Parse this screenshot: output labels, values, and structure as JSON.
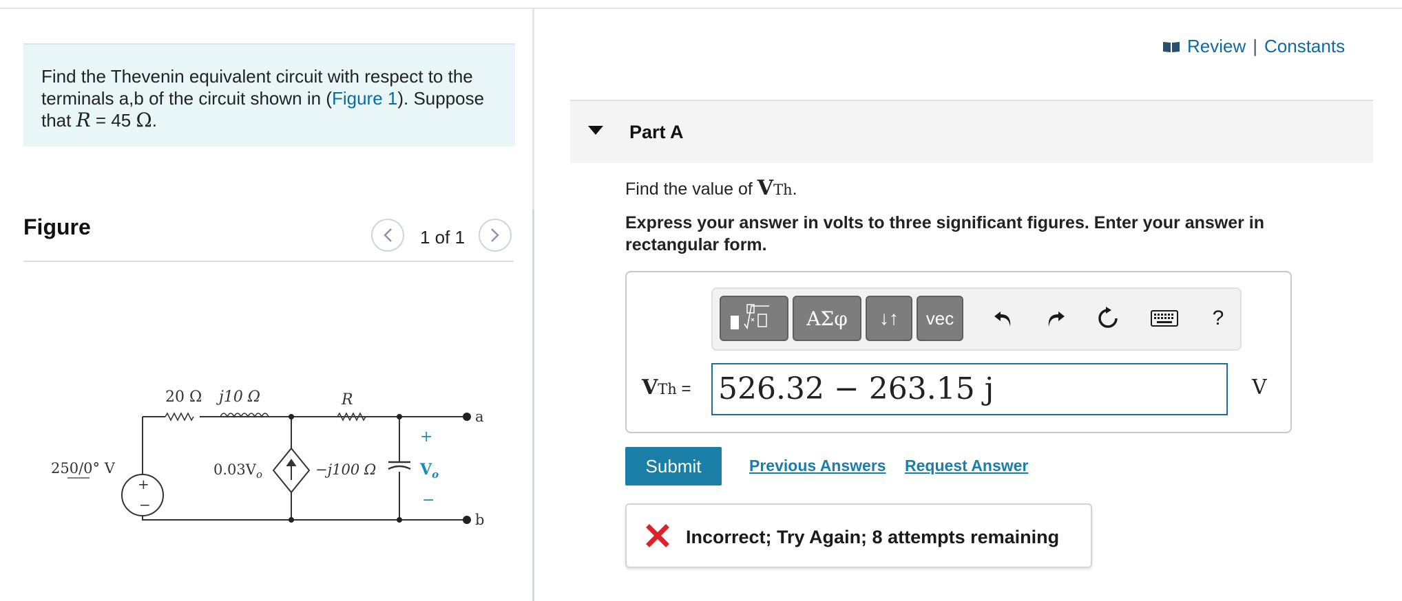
{
  "problem": {
    "text_before": "Find the Thevenin equivalent circuit with respect to the terminals a,b of the circuit shown in (",
    "figure_link": "Figure 1",
    "text_after": "). Suppose that ",
    "r_symbol": "R",
    "r_value": " = 45 ",
    "r_unit": "Ω",
    "period": "."
  },
  "figure": {
    "title": "Figure",
    "counter": "1 of 1",
    "prev_icon": "chevron-left-icon",
    "next_icon": "chevron-right-icon",
    "circuit": {
      "r1_label": "20 Ω",
      "l1_label": "j10 Ω",
      "r_label": "R",
      "source_label": "250/0° V",
      "dep_source_label": "0.03V",
      "dep_source_sub": "o",
      "cap_label": "−j100 Ω",
      "vo_label": "V",
      "vo_sub": "o",
      "plus": "+",
      "minus": "−",
      "terminal_a": "a",
      "terminal_b": "b"
    }
  },
  "header_links": {
    "icon": "book-icon",
    "review": "Review",
    "separator": "|",
    "constants": "Constants"
  },
  "part": {
    "title": "Part A",
    "question_prefix": "Find the value of ",
    "question_var": "V",
    "question_sub": "Th",
    "question_suffix": ".",
    "instruction": "Express your answer in volts to three significant figures. Enter your answer in rectangular form."
  },
  "toolbar": {
    "greek_label": "ΑΣφ",
    "arrows_label": "↓↑",
    "vec_label": "vec",
    "help_label": "?",
    "icons": [
      "templates-icon",
      "undo-icon",
      "redo-icon",
      "reset-icon",
      "keyboard-icon",
      "help-icon"
    ]
  },
  "answer": {
    "label_var": "V",
    "label_sub": "Th",
    "label_eq": " =",
    "value": "526.32 − 263.15 j",
    "unit": "V"
  },
  "actions": {
    "submit": "Submit",
    "previous_answers": "Previous Answers",
    "request_answer": "Request Answer"
  },
  "feedback": {
    "icon": "x-icon",
    "message": "Incorrect; Try Again; 8 attempts remaining",
    "color": "#e0202a"
  },
  "colors": {
    "accent": "#1a7ea7",
    "link": "#0e6b9e",
    "problem_bg": "#e8f6f8"
  }
}
